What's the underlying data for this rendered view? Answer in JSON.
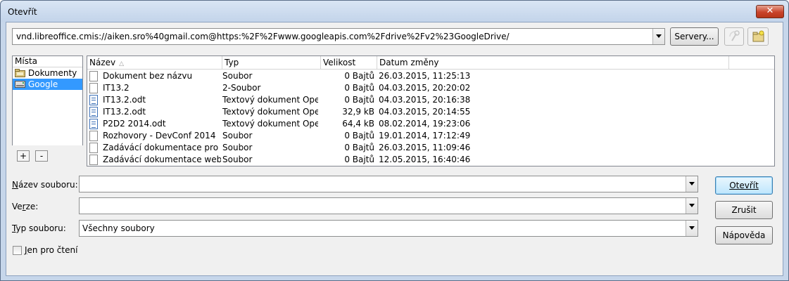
{
  "window": {
    "title": "Otevřít",
    "close_glyph": "✕"
  },
  "location": {
    "url": "vnd.libreoffice.cmis://aiken.sro%40gmail.com@https:%2F%2Fwww.googleapis.com%2Fdrive%2Fv2%23GoogleDrive/",
    "servers_label": "Servery..."
  },
  "places": {
    "header": "Místa",
    "items": [
      {
        "label": "Dokumenty",
        "icon": "folder-icon",
        "selected": false
      },
      {
        "label": "Google",
        "icon": "drive-icon",
        "selected": true
      }
    ],
    "add_label": "+",
    "remove_label": "-"
  },
  "files": {
    "columns": {
      "name": "Název",
      "type": "Typ",
      "size": "Velikost",
      "modified": "Datum změny"
    },
    "rows": [
      {
        "name": "Dokument bez názvu",
        "type": "Soubor",
        "size": "0 Bajtů",
        "modified": "26.03.2015, 11:25:13",
        "icon": "file-icon"
      },
      {
        "name": "IT13.2",
        "type": "2-Soubor",
        "size": "0 Bajtů",
        "modified": "04.03.2015, 20:20:02",
        "icon": "file-icon"
      },
      {
        "name": "IT13.2.odt",
        "type": "Textový dokument Open",
        "size": "0 Bajtů",
        "modified": "04.03.2015, 20:16:38",
        "icon": "document-icon"
      },
      {
        "name": "IT13.2.odt",
        "type": "Textový dokument Open",
        "size": "32,9 kB",
        "modified": "04.03.2015, 20:14:55",
        "icon": "document-icon"
      },
      {
        "name": "P2D2 2014.odt",
        "type": "Textový dokument Open",
        "size": "64,4 kB",
        "modified": "08.02.2014, 19:23:06",
        "icon": "document-icon"
      },
      {
        "name": "Rozhovory - DevConf 2014",
        "type": "Soubor",
        "size": "0 Bajtů",
        "modified": "19.01.2014, 17:12:49",
        "icon": "file-icon"
      },
      {
        "name": "Zadávácí dokumentace pro W",
        "type": "Soubor",
        "size": "0 Bajtů",
        "modified": "26.03.2015, 11:09:46",
        "icon": "file-icon"
      },
      {
        "name": "Zadávácí dokumentace web",
        "type": "Soubor",
        "size": "0 Bajtů",
        "modified": "12.05.2015, 16:40:46",
        "icon": "file-icon"
      }
    ]
  },
  "form": {
    "filename": {
      "label_u": "N",
      "label_rest": "ázev souboru:",
      "value": ""
    },
    "version": {
      "label_pre": "Ve",
      "label_u": "r",
      "label_rest": "ze:",
      "value": ""
    },
    "filetype": {
      "label_u": "T",
      "label_rest": "yp souboru:",
      "value": "Všechny soubory"
    },
    "readonly": {
      "label_u": "J",
      "label_rest": "en pro čtení",
      "checked": false
    }
  },
  "buttons": {
    "open": "Otevřít",
    "cancel": "Zrušit",
    "help": "Nápověda"
  }
}
